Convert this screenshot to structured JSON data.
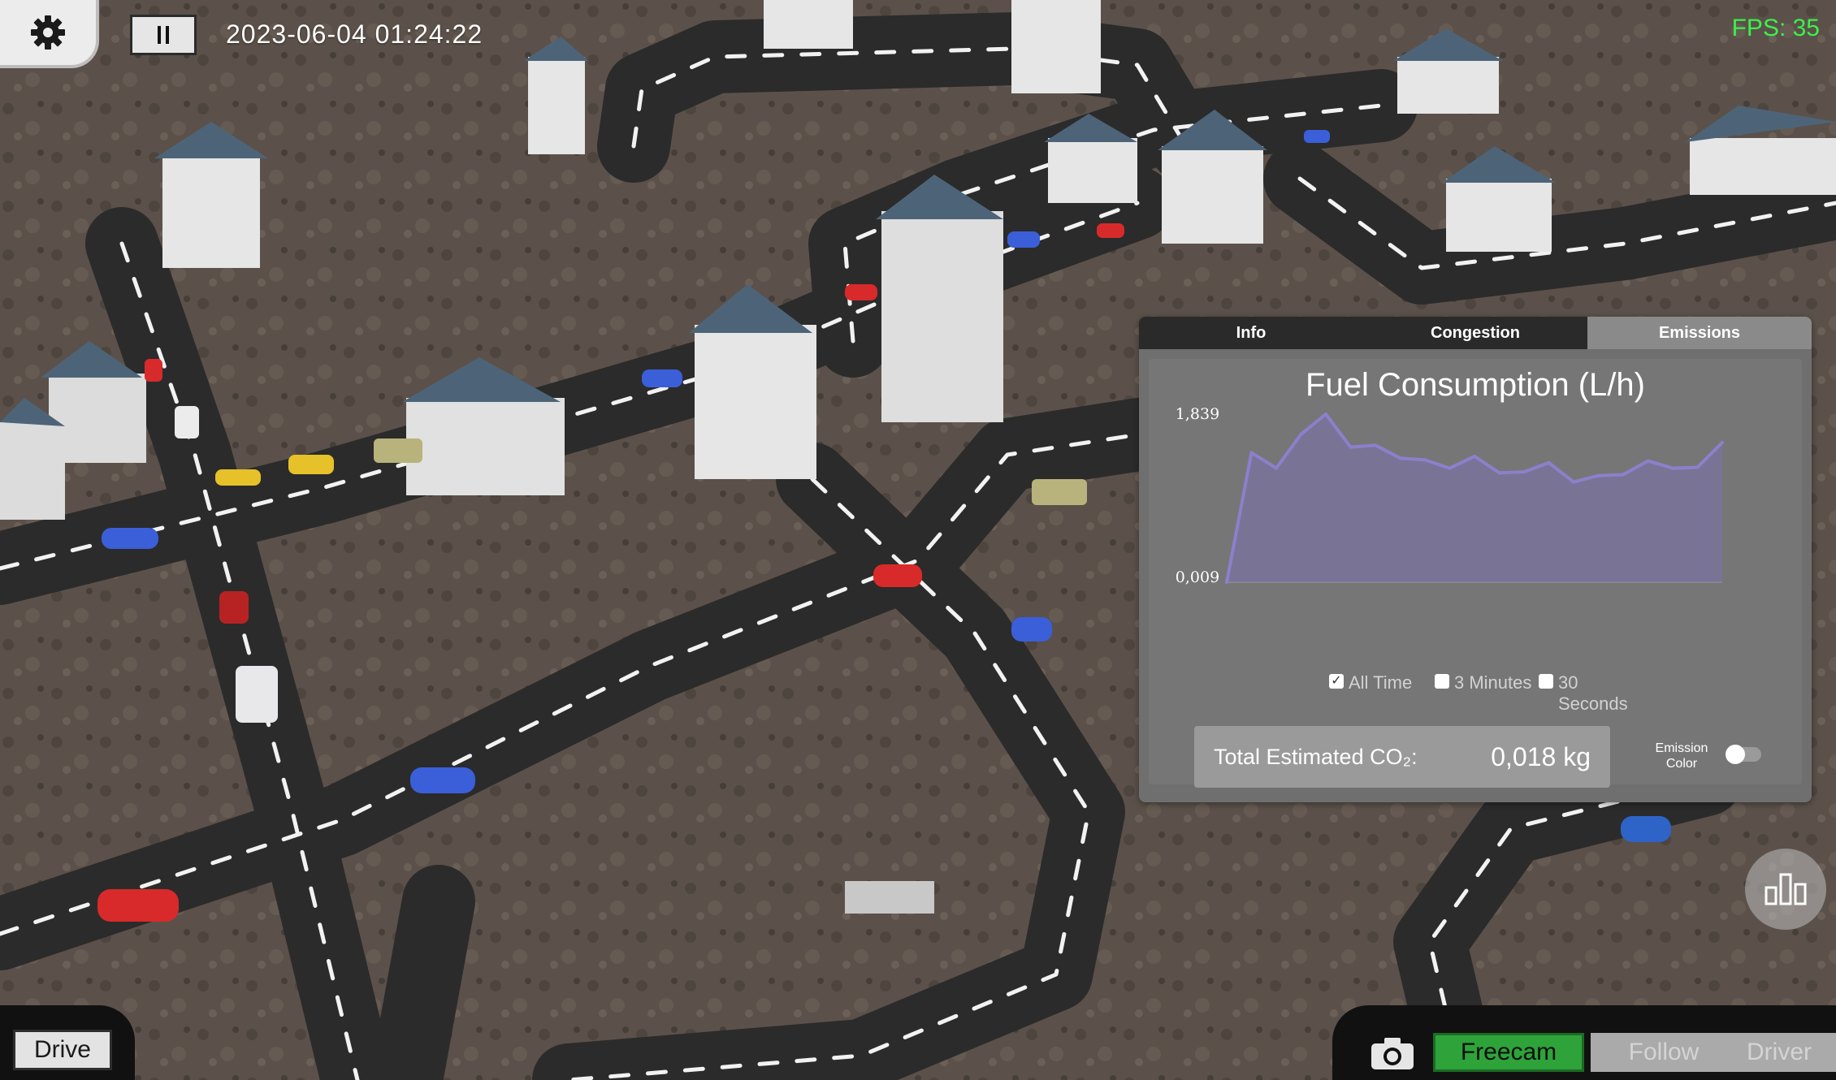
{
  "hud": {
    "timestamp": "2023-06-04 01:24:22",
    "fps": "FPS: 35"
  },
  "panel": {
    "tabs": [
      {
        "label": "Info",
        "active": false
      },
      {
        "label": "Congestion",
        "active": false
      },
      {
        "label": "Emissions",
        "active": true
      }
    ],
    "total_co2_label": "Total Estimated CO₂:",
    "total_co2_value": "0,018 kg",
    "emission_color_label": "Emission Color",
    "emission_color_on": false,
    "time_ranges": [
      {
        "label": "All Time",
        "checked": true
      },
      {
        "label": "3 Minutes",
        "checked": false
      },
      {
        "label": "30 Seconds",
        "checked": false
      }
    ]
  },
  "chart_data": {
    "type": "area",
    "title": "Fuel Consumption (L/h)",
    "y_tick_labels": [
      "1,839",
      "0,009"
    ],
    "ylim": [
      0.009,
      1.839
    ],
    "grid": false,
    "legend": "none",
    "color": "#7b6fb5",
    "values": [
      0.009,
      1.42,
      1.25,
      1.62,
      1.839,
      1.48,
      1.5,
      1.36,
      1.34,
      1.25,
      1.38,
      1.2,
      1.21,
      1.31,
      1.1,
      1.17,
      1.18,
      1.33,
      1.25,
      1.26,
      1.53
    ]
  },
  "controls": {
    "drive_label": "Drive",
    "camera_modes": [
      {
        "label": "Freecam",
        "active": true
      },
      {
        "label": "Follow",
        "active": false
      },
      {
        "label": "Driver",
        "active": false
      }
    ]
  },
  "icons": {
    "settings": "gear-icon",
    "pause": "pause-icon",
    "stats": "bar-chart-icon",
    "camera": "camera-icon"
  },
  "colors": {
    "fps": "#3cf04a",
    "freecam_active": "#2ea33a",
    "chart_fill": "#7b6fb5"
  }
}
